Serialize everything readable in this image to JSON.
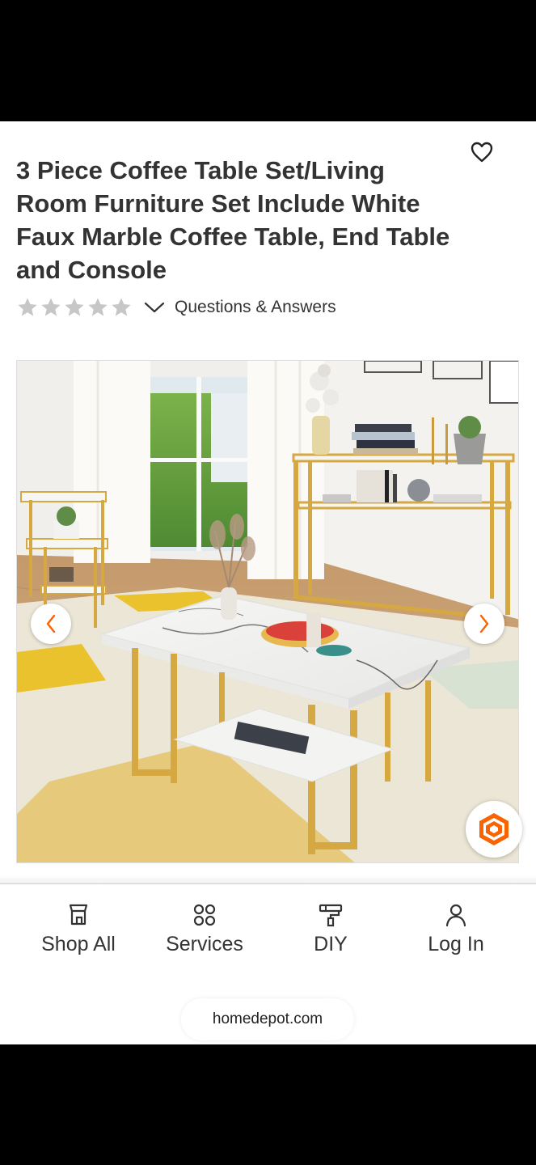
{
  "product": {
    "title": "3 Piece Coffee Table Set/Living Room Furniture Set Include White Faux Marble Coffee Table, End Table and Console",
    "rating": 0,
    "rating_max": 5,
    "qa_link": "Questions & Answers",
    "favorite_icon": "heart-outline-icon",
    "image_alt": "White faux marble coffee table, end table and console with gold frames in a living room"
  },
  "gallery": {
    "prev_icon": "chevron-left-icon",
    "next_icon": "chevron-right-icon",
    "ar_icon": "hexagon-view-icon"
  },
  "bottom_nav": {
    "items": [
      {
        "label": "Shop All",
        "icon": "store-icon"
      },
      {
        "label": "Services",
        "icon": "grid-circles-icon"
      },
      {
        "label": "DIY",
        "icon": "paint-roller-icon"
      },
      {
        "label": "Log In",
        "icon": "person-icon"
      }
    ]
  },
  "browser": {
    "url": "homedepot.com"
  },
  "colors": {
    "accent_orange": "#f96302",
    "text": "#333333",
    "star_empty": "#c7c7c7"
  }
}
